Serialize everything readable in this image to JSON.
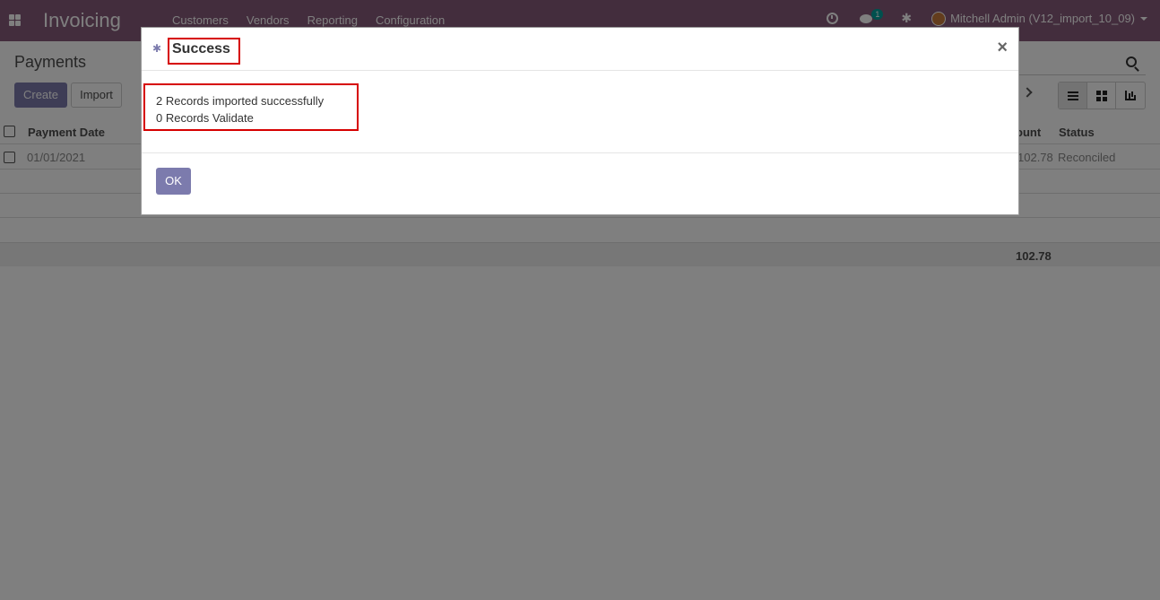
{
  "navbar": {
    "app_name": "Invoicing",
    "menu": [
      "Customers",
      "Vendors",
      "Reporting",
      "Configuration"
    ],
    "chat_badge": "1",
    "user_name": "Mitchell Admin (V12_import_10_09)"
  },
  "control_panel": {
    "title": "Payments",
    "create_label": "Create",
    "import_label": "Import"
  },
  "list": {
    "columns": {
      "payment_date": "Payment Date",
      "amount": "ount",
      "status": "Status"
    },
    "rows": [
      {
        "payment_date": "01/01/2021",
        "amount": "102.78",
        "status": "Reconciled"
      }
    ],
    "footer_total": "102.78"
  },
  "modal": {
    "title": "Success",
    "messages": [
      "2 Records imported successfully",
      "0 Records Validate"
    ],
    "ok_label": "OK",
    "close_label": "×"
  },
  "colors": {
    "navbar": "#875a7b",
    "primary_button": "#7c7bad",
    "highlight": "#d60000"
  }
}
